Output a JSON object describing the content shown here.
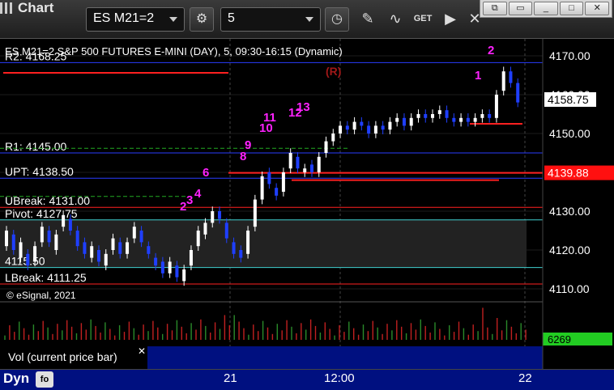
{
  "toolbar": {
    "app_title": "Chart",
    "symbol": "ES M21=2",
    "interval": "5",
    "get_label": "GET"
  },
  "colors": {
    "background": "#000000",
    "up_bar": "#ffffff",
    "down_bar": "#1f3fff",
    "pivot_red": "#ff2020",
    "pivot_blue": "#2a3cff",
    "dashed_green": "#22aa22",
    "counter_magenta": "#ff22ff",
    "current_price_box": "#ffffff",
    "last_price_box": "#ff1010",
    "volume_box": "#22cc22",
    "volume_bars": "#c02020"
  },
  "chart": {
    "header": "ES M21=2 S&P 500 FUTURES E-MINI (DAY), 5, 09:30-16:15 (Dynamic)",
    "copyright": "© eSignal, 2021",
    "r_marker": "(R)",
    "y_ticks": [
      "4170.00",
      "4160.00",
      "4150.00",
      "4140.00",
      "4130.00",
      "4120.00",
      "4110.00"
    ],
    "y_tick_values": [
      4170,
      4160,
      4150,
      4140,
      4130,
      4120,
      4110
    ],
    "x_ticks": [
      "21",
      "12:00",
      "22"
    ],
    "current_price": "4158.75",
    "current_price_value": 4158.75,
    "stop_price": "4139.88",
    "stop_price_value": 4139.88,
    "levels": [
      {
        "label": "R2: 4168.25",
        "value": 4168.25,
        "color": "#2a3cff"
      },
      {
        "label": "R1: 4145.00",
        "value": 4145.0,
        "color": "#2a3cff"
      },
      {
        "label": "UPT: 4138.50",
        "value": 4138.5,
        "color": "#2a3cff"
      },
      {
        "label": "UBreak: 4131.00",
        "value": 4131.0,
        "color": "#ff2020"
      },
      {
        "label": "Pivot: 4127.75",
        "value": 4127.75,
        "color": "#40d0d0"
      },
      {
        "label": "4115.50",
        "value": 4115.5,
        "color": "#40d0d0"
      },
      {
        "label": "LBreak: 4111.25",
        "value": 4111.25,
        "color": "#ff2020"
      }
    ],
    "vol_label": "Vol (current price bar)",
    "vol_value": "6269",
    "counters": [
      "2",
      "3",
      "4",
      "6",
      "8",
      "9",
      "10",
      "11",
      "12",
      "13",
      "1",
      "2",
      "2"
    ]
  },
  "bottom": {
    "dyn_label": "Dyn"
  }
}
